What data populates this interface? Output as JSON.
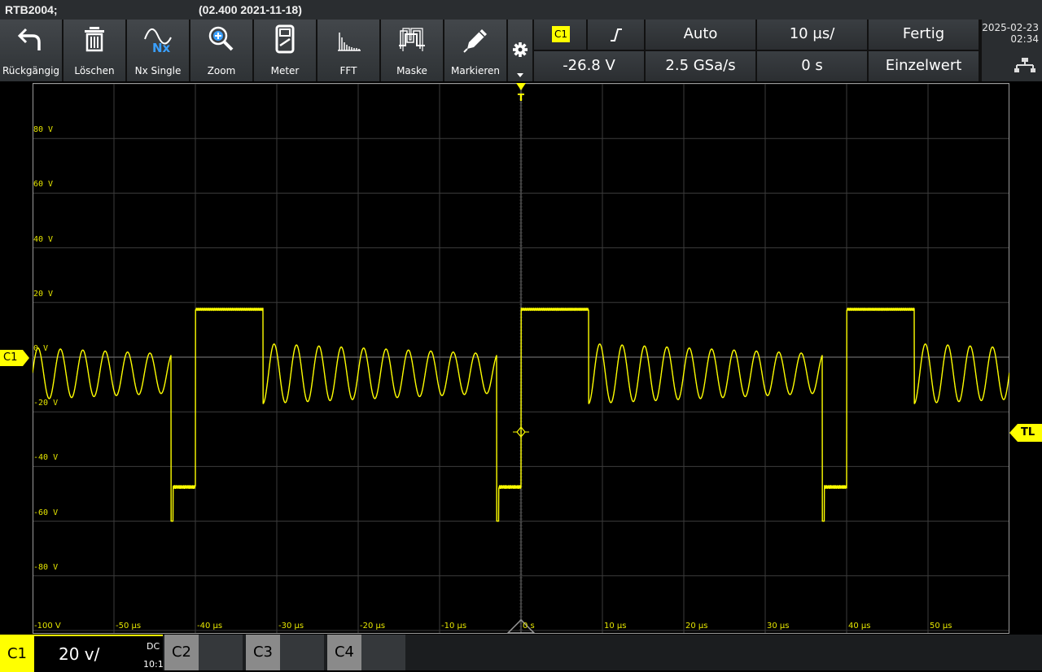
{
  "titlebar": {
    "model": "RTB2004;",
    "firmware": "(02.400 2021-11-18)"
  },
  "toolbar": [
    {
      "label": "Rückgängig",
      "icon": "undo-icon"
    },
    {
      "label": "Löschen",
      "icon": "trash-icon"
    },
    {
      "label": "Nx Single",
      "icon": "nx-single-icon"
    },
    {
      "label": "Zoom",
      "icon": "zoom-icon"
    },
    {
      "label": "Meter",
      "icon": "meter-icon"
    },
    {
      "label": "FFT",
      "icon": "fft-icon"
    },
    {
      "label": "Maske",
      "icon": "mask-icon"
    },
    {
      "label": "Markieren",
      "icon": "marker-pen-icon"
    }
  ],
  "settings": {
    "trigger_source": "C1",
    "trigger_level": "-26.8 V",
    "trigger_mode": "Auto",
    "sample_rate": "2.5 GSa/s",
    "timebase": "10 µs/",
    "position": "0 s",
    "acq_state": "Fertig",
    "acq_mode": "Einzelwert"
  },
  "datetime": {
    "date": "2025-02-23",
    "time": "02:34"
  },
  "markers": {
    "channel": "C1",
    "trigger_level": "TL",
    "trigger": "T"
  },
  "channels": [
    {
      "name": "C1",
      "scale": "20 v/",
      "coupling": "DC",
      "probe": "10:1",
      "active": true,
      "color": "#ffff00"
    },
    {
      "name": "C2",
      "active": false,
      "color": "#8a8a8a"
    },
    {
      "name": "C3",
      "active": false,
      "color": "#8a8a8a"
    },
    {
      "name": "C4",
      "active": false,
      "color": "#8a8a8a"
    }
  ],
  "chart_data": {
    "type": "line",
    "x_tick_labels": [
      "-100 V",
      "-50 µs",
      "-40 µs",
      "-30 µs",
      "-20 µs",
      "-10 µs",
      "0 s",
      "10 µs",
      "20 µs",
      "30 µs",
      "40 µs",
      "50 µs"
    ],
    "y_tick_labels": [
      "80 V",
      "60 V",
      "40 V",
      "20 V",
      "0 V",
      "-20 V",
      "-40 V",
      "-60 V",
      "-80 V"
    ],
    "xlim": [
      -60,
      60
    ],
    "ylim": [
      -100,
      100
    ],
    "grid": true,
    "color": "#ffff00",
    "trace": {
      "period": 40,
      "pulse_high": [
        -40,
        -31.7
      ],
      "high_level": 17.5,
      "low_segment": [
        -43,
        -40
      ],
      "low_level": -47.5,
      "spike_level": -60,
      "osc_center": -6,
      "osc_period": 2.75
    }
  }
}
